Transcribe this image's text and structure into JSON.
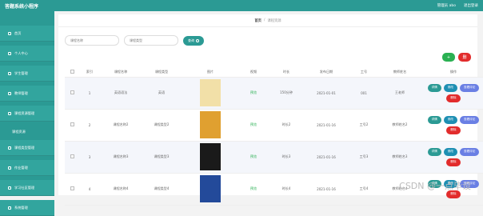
{
  "header": {
    "app_title": "答题系统小程序",
    "user": "管理员 abo",
    "logout": "退出登录"
  },
  "sidebar": {
    "items": [
      {
        "label": "首页"
      },
      {
        "label": "个人中心"
      },
      {
        "label": "学生管理"
      },
      {
        "label": "教师管理"
      },
      {
        "label": "课程资源管理"
      },
      {
        "label": "课程资源",
        "sub": true
      },
      {
        "label": "课程类型管理"
      },
      {
        "label": "作业管理"
      },
      {
        "label": "学习社区管理"
      },
      {
        "label": "系统管理"
      }
    ]
  },
  "breadcrumb": {
    "home": "首页",
    "sep": "/",
    "current": "课程资源"
  },
  "filters": {
    "name_placeholder": "课程名称",
    "type_placeholder": "课程类型",
    "search_label": "查询"
  },
  "actions": {
    "add_label": "+",
    "delete_label": "删"
  },
  "table": {
    "headers": [
      "",
      "索引",
      "课程名称",
      "课程类型",
      "图片",
      "视频",
      "时长",
      "发布日期",
      "工号",
      "教师姓名",
      "操作"
    ],
    "video_label": "预览",
    "ops": {
      "detail": "详情",
      "edit": "修改",
      "review": "查看评论",
      "remove": "删除"
    },
    "rows": [
      {
        "index": "1",
        "name": "英语语法",
        "type": "英语",
        "duration": "150分钟",
        "date": "2021-01-01",
        "tno": "001",
        "teacher": "王老师",
        "thumb_color": "#f2e0a8"
      },
      {
        "index": "2",
        "name": "课程名称2",
        "type": "课程类型2",
        "duration": "时长2",
        "date": "2021-01-16",
        "tno": "工号2",
        "teacher": "教师姓名2",
        "thumb_color": "#e0a030"
      },
      {
        "index": "3",
        "name": "课程名称3",
        "type": "课程类型3",
        "duration": "时长3",
        "date": "2021-01-16",
        "tno": "工号3",
        "teacher": "教师姓名3",
        "thumb_color": "#1a1a1a"
      },
      {
        "index": "4",
        "name": "课程名称4",
        "type": "课程类型4",
        "duration": "时长4",
        "date": "2021-01-16",
        "tno": "工号4",
        "teacher": "教师姓名4",
        "thumb_color": "#234a9a"
      }
    ]
  },
  "watermark": "CSDN @一点毕设"
}
